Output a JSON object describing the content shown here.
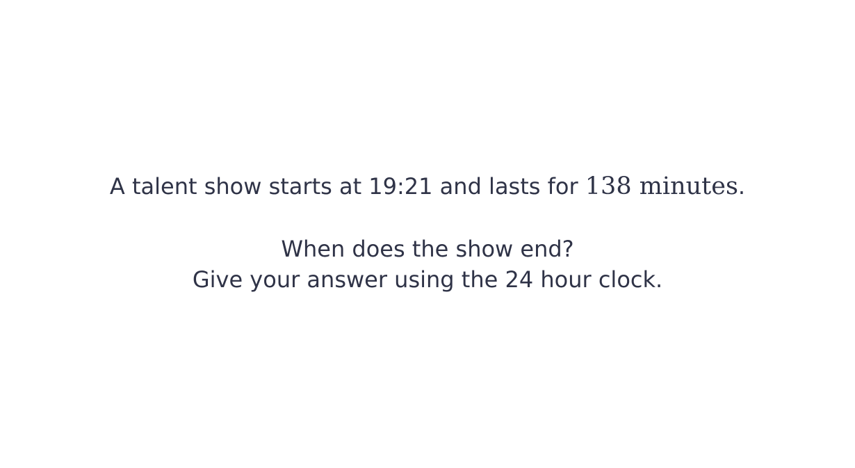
{
  "question": {
    "line1": {
      "prefix": "A talent show starts at 19:21 and lasts for ",
      "math": "138 minutes",
      "suffix": "."
    },
    "line2": "When does the show end?",
    "line3": "Give your answer using the 24 hour clock."
  },
  "colors": {
    "text": "#2f3347",
    "background": "#ffffff"
  }
}
